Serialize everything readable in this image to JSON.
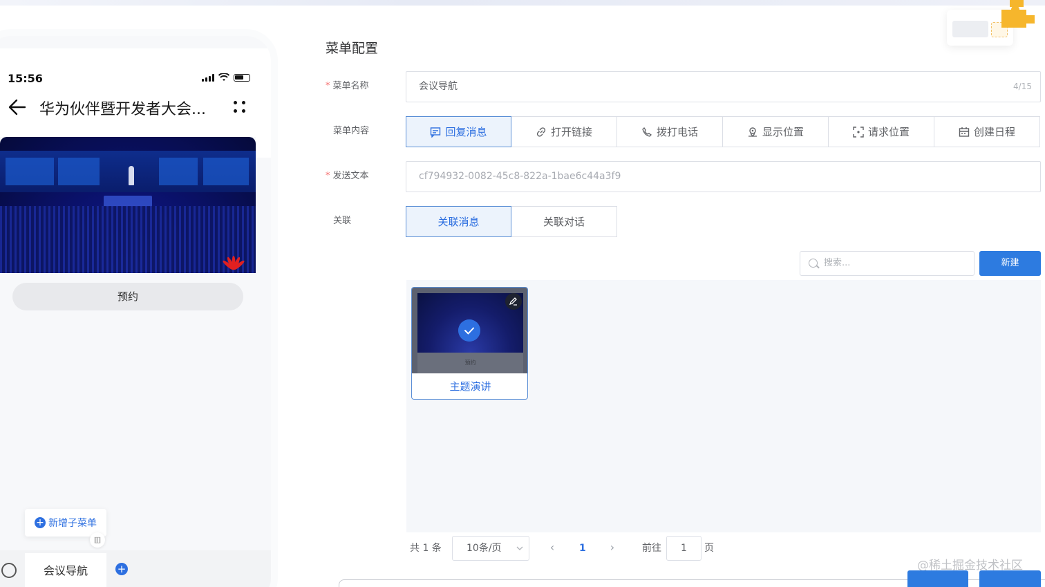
{
  "phone": {
    "time": "15:56",
    "chat_title": "华为伙伴暨开发者大会...",
    "reserve_label": "预约",
    "add_submenu_label": "新增子菜单",
    "menu_tab_label": "会议导航"
  },
  "form": {
    "section_title": "菜单配置",
    "menu_name_label": "菜单名称",
    "menu_name_value": "会议导航",
    "menu_name_count": "4/15",
    "menu_content_label": "菜单内容",
    "content_options": [
      "回复消息",
      "打开链接",
      "拨打电话",
      "显示位置",
      "请求位置",
      "创建日程"
    ],
    "content_selected": "回复消息",
    "send_text_label": "发送文本",
    "send_text_value": "cf794932-0082-45c8-822a-1bae6c44a3f9",
    "relation_label": "关联",
    "relation_options": [
      "关联消息",
      "关联对话"
    ],
    "relation_selected": "关联消息"
  },
  "toolbar": {
    "search_placeholder": "搜索...",
    "new_label": "新建"
  },
  "gallery": {
    "cards": [
      {
        "caption": "主题演讲",
        "thumb_label": "预约",
        "selected": true
      }
    ]
  },
  "pagination": {
    "total_text": "共 1 条",
    "page_size": "10条/页",
    "current_page": "1",
    "goto_label": "前往",
    "goto_value": "1",
    "page_suffix": "页"
  },
  "watermark": "@稀土掘金技术社区",
  "colors": {
    "accent": "#2d6fe0",
    "required_star": "#f56c6c",
    "selected_bg": "#ecf3fc"
  }
}
